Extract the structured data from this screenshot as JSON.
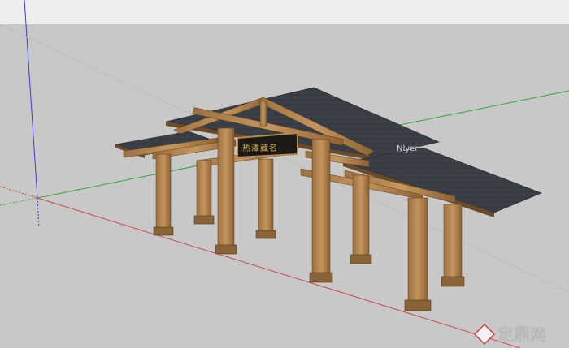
{
  "scene": {
    "sign_text": "热澤藏名",
    "watermark_center": "Nlyer",
    "watermark_brand": "定鼎网",
    "colors": {
      "sky": "#eeeeee",
      "ground": "#c8c8c8",
      "wood": "#b88a55",
      "wood_dark": "#8b6338",
      "roof": "#3a3f47",
      "axis_blue": "#3b3bdc",
      "axis_green": "#3aa53a",
      "axis_red": "#c84a4a"
    }
  }
}
